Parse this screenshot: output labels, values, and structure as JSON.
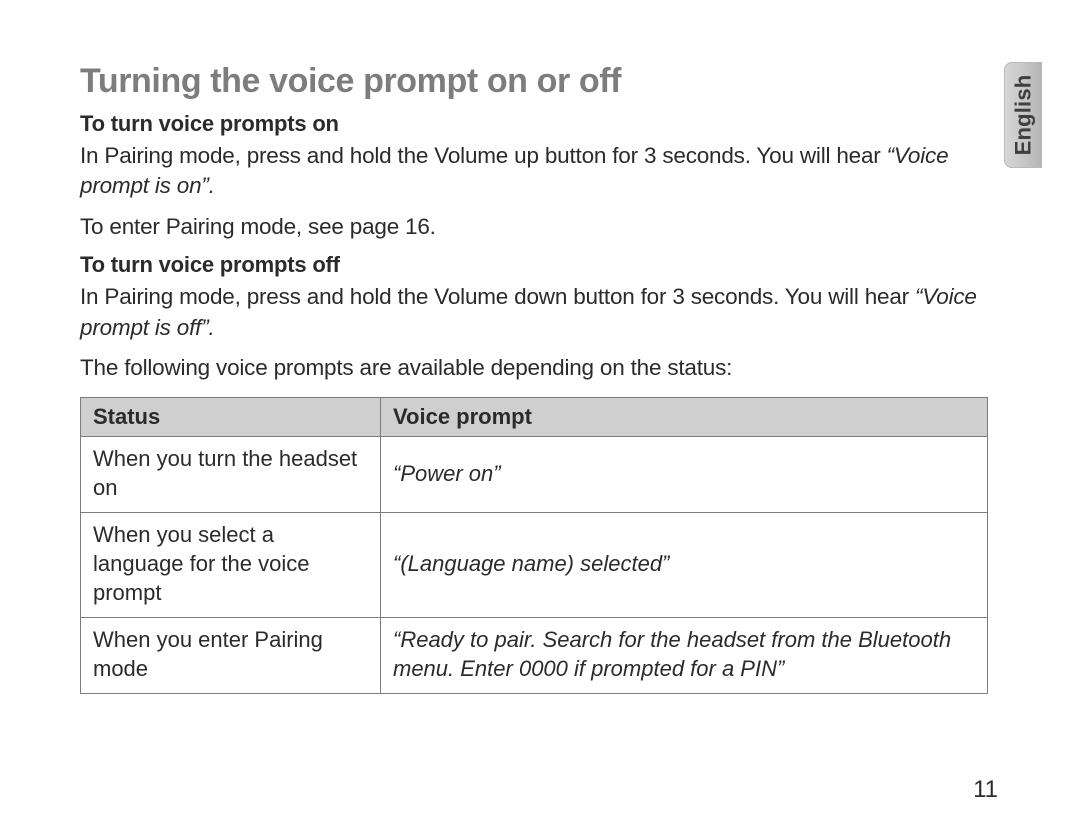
{
  "language_tab": "English",
  "title": "Turning the voice prompt on or off",
  "section_on": {
    "heading": "To turn voice prompts on",
    "body_1": "In Pairing mode, press and hold the Volume up button for 3 seconds. You will hear ",
    "quote": "“Voice prompt is on”.",
    "body_2": "To enter Pairing mode, see page 16."
  },
  "section_off": {
    "heading": "To turn voice prompts off",
    "body_1": "In Pairing mode, press and hold the Volume down button for 3 seconds. You will hear ",
    "quote": "“Voice prompt is off”.",
    "body_2": "The following voice prompts are available depending on the status:"
  },
  "table": {
    "headers": {
      "status": "Status",
      "prompt": "Voice prompt"
    },
    "rows": [
      {
        "status": "When you turn the headset on",
        "prompt": "“Power on”"
      },
      {
        "status": "When you select a language for the voice prompt",
        "prompt": "“(Language name) selected”"
      },
      {
        "status": "When you enter Pairing mode",
        "prompt": "“Ready to pair. Search for the headset from the Bluetooth menu. Enter 0000 if prompted for a PIN”"
      }
    ]
  },
  "page_number": "11"
}
